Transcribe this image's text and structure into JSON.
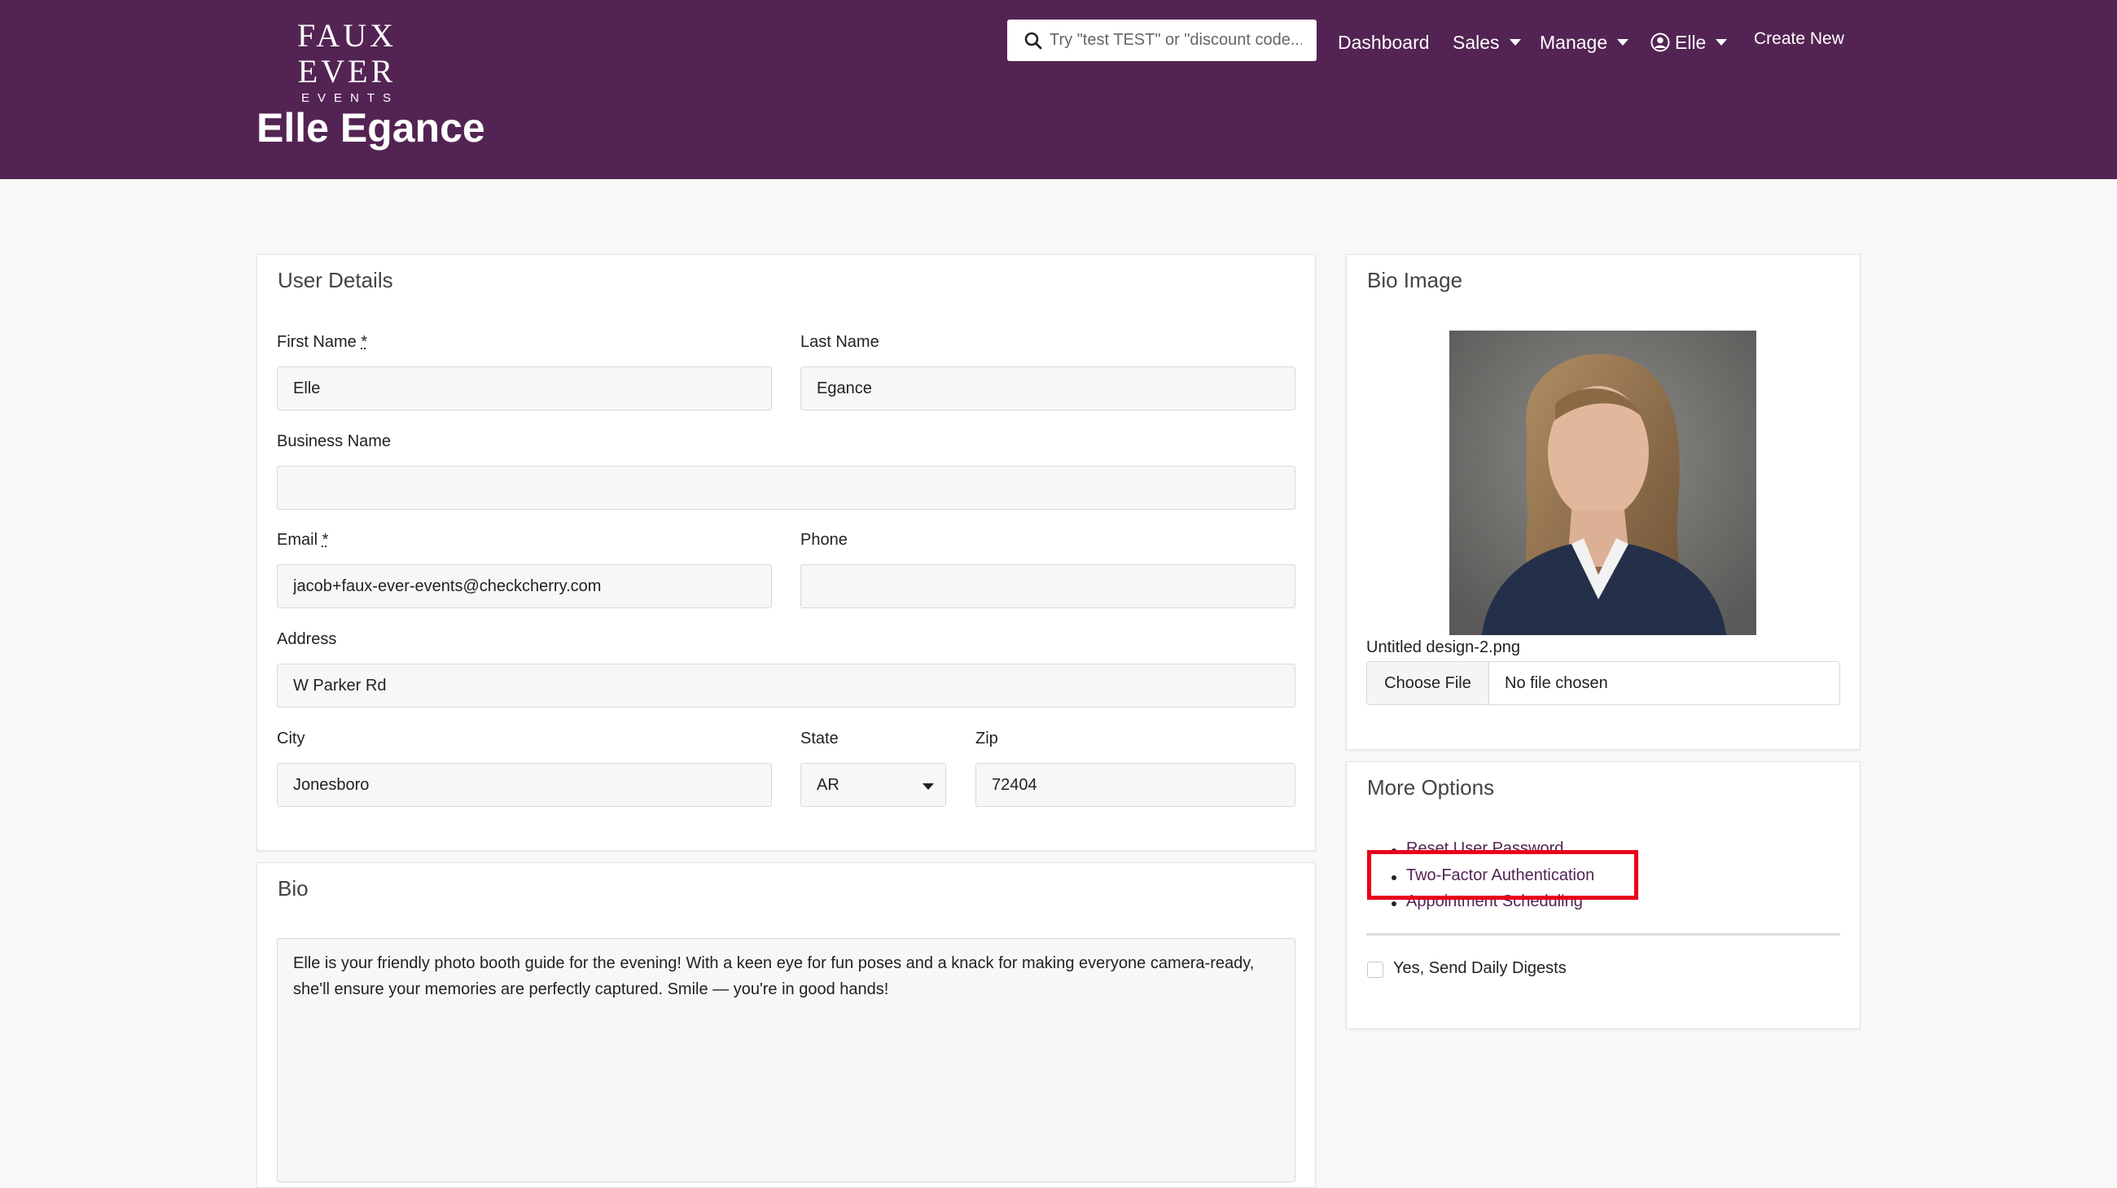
{
  "brand": {
    "name_line1": "FAUX EVER",
    "name_line2": "EVENTS"
  },
  "search": {
    "placeholder": "Try \"test TEST\" or \"discount code..."
  },
  "nav": {
    "dashboard": "Dashboard",
    "sales": "Sales",
    "manage": "Manage",
    "user": "Elle",
    "create_new": "Create New"
  },
  "page_title": "Elle Egance",
  "user_details": {
    "title": "User Details",
    "first_name_label": "First Name",
    "first_name": "Elle",
    "last_name_label": "Last Name",
    "last_name": "Egance",
    "business_name_label": "Business Name",
    "business_name": "",
    "email_label": "Email",
    "email": "jacob+faux-ever-events@checkcherry.com",
    "phone_label": "Phone",
    "phone": "",
    "address_label": "Address",
    "address": "W Parker Rd",
    "city_label": "City",
    "city": "Jonesboro",
    "state_label": "State",
    "state": "AR",
    "zip_label": "Zip",
    "zip": "72404",
    "required_marker": "*"
  },
  "bio": {
    "title": "Bio",
    "text": "Elle is your friendly photo booth guide for the evening! With a keen eye for fun poses and a knack for making everyone camera-ready, she'll ensure your memories are perfectly captured. Smile — you're in good hands!"
  },
  "bio_image": {
    "title": "Bio Image",
    "filename": "Untitled design-2.png",
    "choose_file": "Choose File",
    "no_file": "No file chosen"
  },
  "more_options": {
    "title": "More Options",
    "links": [
      "Reset User Password",
      "Two-Factor Authentication",
      "Appointment Scheduling"
    ],
    "daily_digest_label": "Yes, Send Daily Digests",
    "daily_digest_checked": false
  },
  "colors": {
    "header": "#532453",
    "highlight": "#e8001c",
    "link": "#532453"
  }
}
